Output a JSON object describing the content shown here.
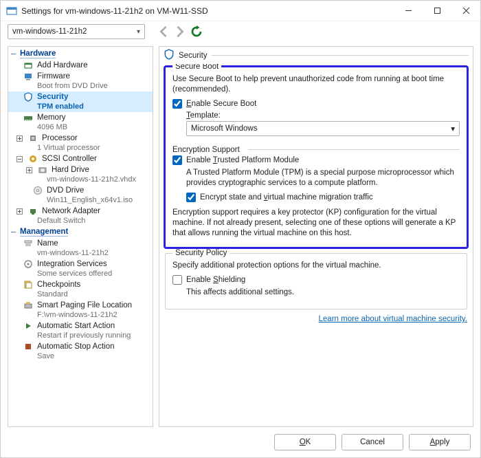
{
  "window": {
    "title": "Settings for vm-windows-11-21h2 on VM-W11-SSD"
  },
  "toolbar": {
    "vm_dropdown": "vm-windows-11-21h2"
  },
  "sidebar": {
    "hardware_label": "Hardware",
    "management_label": "Management",
    "add_hardware": "Add Hardware",
    "firmware": {
      "label": "Firmware",
      "sub": "Boot from DVD Drive"
    },
    "security": {
      "label": "Security",
      "sub": "TPM enabled"
    },
    "memory": {
      "label": "Memory",
      "sub": "4096 MB"
    },
    "processor": {
      "label": "Processor",
      "sub": "1 Virtual processor"
    },
    "scsi": {
      "label": "SCSI Controller"
    },
    "hard_drive": {
      "label": "Hard Drive",
      "sub": "vm-windows-11-21h2.vhdx"
    },
    "dvd_drive": {
      "label": "DVD Drive",
      "sub": "Win11_English_x64v1.iso"
    },
    "net": {
      "label": "Network Adapter",
      "sub": "Default Switch"
    },
    "name": {
      "label": "Name",
      "sub": "vm-windows-11-21h2"
    },
    "integration": {
      "label": "Integration Services",
      "sub": "Some services offered"
    },
    "checkpoints": {
      "label": "Checkpoints",
      "sub": "Standard"
    },
    "smart_paging": {
      "label": "Smart Paging File Location",
      "sub": "F:\\vm-windows-11-21h2"
    },
    "auto_start": {
      "label": "Automatic Start Action",
      "sub": "Restart if previously running"
    },
    "auto_stop": {
      "label": "Automatic Stop Action",
      "sub": "Save"
    }
  },
  "right": {
    "header": "Security",
    "secure_boot": {
      "title": "Secure Boot",
      "desc": "Use Secure Boot to help prevent unauthorized code from running at boot time (recommended).",
      "enable_label_pre": "",
      "enable_label": "Enable Secure Boot",
      "template_label": "Template:",
      "template_value": "Microsoft Windows"
    },
    "encryption": {
      "title": "Encryption Support",
      "enable_tpm_label": "Enable Trusted Platform Module",
      "tpm_desc": "A Trusted Platform Module (TPM) is a special purpose microprocessor which provides cryptographic services to a compute platform.",
      "encrypt_label_a": "Encrypt state and ",
      "encrypt_label_b": "virtual machine migration traffic",
      "kp_desc": "Encryption support requires a key protector (KP) configuration for the virtual machine. If not already present, selecting one of these options will generate a KP that allows running the virtual machine on this host."
    },
    "policy": {
      "title": "Security Policy",
      "desc": "Specify additional protection options for the virtual machine.",
      "shield_label": "Enable Shielding",
      "shield_note": "This affects additional settings."
    },
    "learn_more": "Learn more about virtual machine security."
  },
  "footer": {
    "ok": "OK",
    "cancel": "Cancel",
    "apply": "Apply"
  }
}
